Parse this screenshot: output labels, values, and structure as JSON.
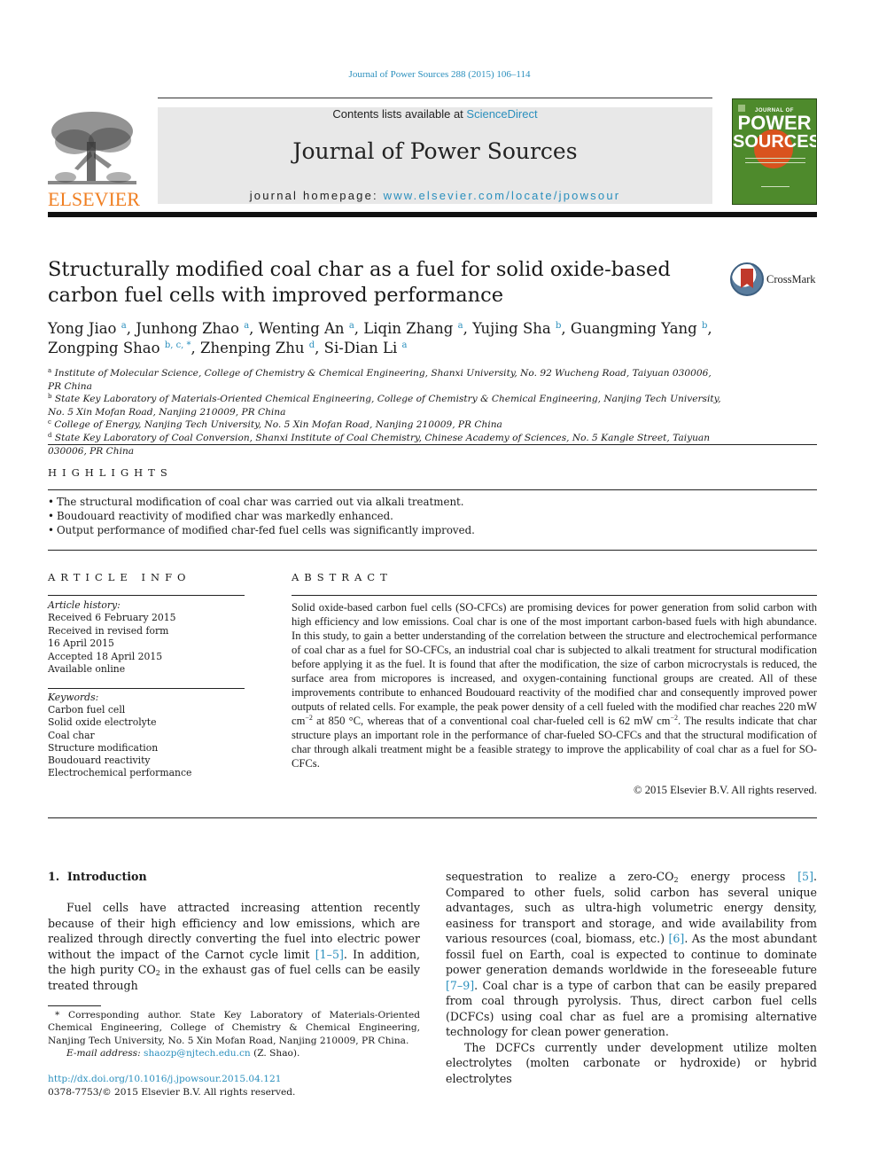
{
  "running_head": "Journal of Power Sources 288 (2015) 106–114",
  "masthead": {
    "contents_prefix": "Contents lists available at ",
    "contents_link": "ScienceDirect",
    "journal_title": "Journal of Power Sources",
    "homepage_prefix": "journal homepage: ",
    "homepage_link": "www.elsevier.com/locate/jpowsour",
    "publisher_logo_text": "ELSEVIER",
    "cover": {
      "line1": "JOURNAL OF",
      "line2": "POWER",
      "line3": "SOURCES",
      "background_color": "#4e8a2c",
      "accent_color": "#d9531e"
    },
    "crossmark_label": "CrossMark"
  },
  "article": {
    "title": "Structurally modified coal char as a fuel for solid oxide-based carbon fuel cells with improved performance",
    "authors": [
      {
        "name": "Yong Jiao",
        "sup": "a"
      },
      {
        "name": "Junhong Zhao",
        "sup": "a"
      },
      {
        "name": "Wenting An",
        "sup": "a"
      },
      {
        "name": "Liqin Zhang",
        "sup": "a"
      },
      {
        "name": "Yujing Sha",
        "sup": "b"
      },
      {
        "name": "Guangming Yang",
        "sup": "b"
      },
      {
        "name": "Zongping Shao",
        "sup": "b, c, *"
      },
      {
        "name": "Zhenping Zhu",
        "sup": "d"
      },
      {
        "name": "Si-Dian Li",
        "sup": "a"
      }
    ],
    "affiliations": [
      {
        "key": "a",
        "text": "Institute of Molecular Science, College of Chemistry & Chemical Engineering, Shanxi University, No. 92 Wucheng Road, Taiyuan 030006, PR China"
      },
      {
        "key": "b",
        "text": "State Key Laboratory of Materials-Oriented Chemical Engineering, College of Chemistry & Chemical Engineering, Nanjing Tech University, No. 5 Xin Mofan Road, Nanjing 210009, PR China"
      },
      {
        "key": "c",
        "text": "College of Energy, Nanjing Tech University, No. 5 Xin Mofan Road, Nanjing 210009, PR China"
      },
      {
        "key": "d",
        "text": "State Key Laboratory of Coal Conversion, Shanxi Institute of Coal Chemistry, Chinese Academy of Sciences, No. 5 Kangle Street, Taiyuan 030006, PR China"
      }
    ]
  },
  "highlights": {
    "heading": "HIGHLIGHTS",
    "items": [
      "The structural modification of coal char was carried out via alkali treatment.",
      "Boudouard reactivity of modified char was markedly enhanced.",
      "Output performance of modified char-fed fuel cells was significantly improved."
    ]
  },
  "article_info": {
    "heading": "ARTICLE INFO",
    "history_label": "Article history:",
    "history": [
      "Received 6 February 2015",
      "Received in revised form",
      "16 April 2015",
      "Accepted 18 April 2015",
      "Available online"
    ],
    "keywords_label": "Keywords:",
    "keywords": [
      "Carbon fuel cell",
      "Solid oxide electrolyte",
      "Coal char",
      "Structure modification",
      "Boudouard reactivity",
      "Electrochemical performance"
    ]
  },
  "abstract": {
    "heading": "ABSTRACT",
    "part1": "Solid oxide-based carbon fuel cells (SO-CFCs) are promising devices for power generation from solid carbon with high efficiency and low emissions. Coal char is one of the most important carbon-based fuels with high abundance. In this study, to gain a better understanding of the correlation between the structure and electrochemical performance of coal char as a fuel for SO-CFCs, an industrial coal char is subjected to alkali treatment for structural modification before applying it as the fuel. It is found that after the modification, the size of carbon microcrystals is reduced, the surface area from micropores is increased, and oxygen-containing functional groups are created. All of these improvements contribute to enhanced Boudouard reactivity of the modified char and consequently improved power outputs of related cells. For example, the peak power density of a cell fueled with the modified char reaches 220 mW cm",
    "sup1": "−2",
    "part2": " at 850 °C, whereas that of a conventional coal char-fueled cell is 62 mW cm",
    "sup2": "−2",
    "part3": ". The results indicate that char structure plays an important role in the performance of char-fueled SO-CFCs and that the structural modification of char through alkali treatment might be a feasible strategy to improve the applicability of coal char as a fuel for SO-CFCs.",
    "copyright": "© 2015 Elsevier B.V. All rights reserved."
  },
  "introduction": {
    "heading": "1.  Introduction",
    "left": {
      "p1_a": "Fuel cells have attracted increasing attention recently because of their high efficiency and low emissions, which are realized through directly converting the fuel into electric power without the impact of the Carnot cycle limit ",
      "ref1": "[1–5]",
      "p1_b": ". In addition, the high purity CO",
      "sub1": "2",
      "p1_c": " in the exhaust gas of fuel cells can be easily treated through"
    },
    "right": {
      "p1_a": "sequestration to realize a zero-CO",
      "sub1": "2",
      "p1_b": " energy process ",
      "ref1": "[5]",
      "p1_c": ". Compared to other fuels, solid carbon has several unique advantages, such as ultra-high volumetric energy density, easiness for transport and storage, and wide availability from various resources (coal, biomass, etc.) ",
      "ref2": "[6]",
      "p1_d": ". As the most abundant fossil fuel on Earth, coal is expected to continue to dominate power generation demands worldwide in the foreseeable future ",
      "ref3": "[7–9]",
      "p1_e": ". Coal char is a type of carbon that can be easily prepared from coal through pyrolysis. Thus, direct carbon fuel cells (DCFCs) using coal char as fuel are a promising alternative technology for clean power generation.",
      "p2": "The DCFCs currently under development utilize molten electrolytes (molten carbonate or hydroxide) or hybrid electrolytes"
    }
  },
  "footnotes": {
    "corresponding": "* Corresponding author. State Key Laboratory of Materials-Oriented Chemical Engineering, College of Chemistry & Chemical Engineering, Nanjing Tech University, No. 5 Xin Mofan Road, Nanjing 210009, PR China.",
    "email_label": "E-mail address: ",
    "email": "shaozp@njtech.edu.cn",
    "email_suffix": " (Z. Shao).",
    "doi": "http://dx.doi.org/10.1016/j.jpowsour.2015.04.121",
    "issn": "0378-7753/© 2015 Elsevier B.V. All rights reserved."
  }
}
